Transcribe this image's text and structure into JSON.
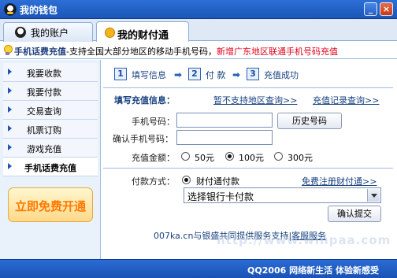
{
  "window": {
    "title": "我的钱包",
    "minimize_label": "_",
    "close_label": "×"
  },
  "tabs": [
    {
      "label": "我的账户",
      "active": false
    },
    {
      "label": "我的财付通",
      "active": true
    }
  ],
  "banner": {
    "bold": "手机话费充值",
    "text": "-支持全国大部分地区的移动手机号码，",
    "highlight": "新增广东地区联通手机号码充值"
  },
  "sidebar": {
    "items": [
      {
        "label": "我要收款",
        "active": false
      },
      {
        "label": "我要付款",
        "active": false
      },
      {
        "label": "交易查询",
        "active": false
      },
      {
        "label": "机票订购",
        "active": false
      },
      {
        "label": "游戏充值",
        "active": false
      },
      {
        "label": "手机话费充值",
        "active": true
      }
    ],
    "promo_button": "立即免费开通"
  },
  "steps": [
    {
      "num": "1",
      "label": "填写信息"
    },
    {
      "num": "2",
      "label": "付 款"
    },
    {
      "num": "3",
      "label": "充值成功"
    }
  ],
  "form": {
    "section_title": "填写充值信息：",
    "unsupported_link": "暂不支持地区查询>>",
    "history_link": "充值记录查询>>",
    "phone_label": "手机号码：",
    "phone_value": "",
    "confirm_label": "确认手机号码：",
    "confirm_value": "",
    "history_button": "历史号码",
    "amount_label": "充值金额：",
    "amounts": [
      {
        "label": "50元",
        "checked": false
      },
      {
        "label": "100元",
        "checked": true
      },
      {
        "label": "300元",
        "checked": false
      }
    ],
    "payment_label": "付款方式：",
    "payment_option": "财付通付款",
    "payment_checked": true,
    "register_link": "免费注册财付通>>",
    "bank_select": "选择银行卡付款",
    "submit_button": "确认提交"
  },
  "footer": {
    "text": "007ka.cn与银盛共同提供服务支持",
    "separator": "|",
    "service_link": "客服服务"
  },
  "statusbar": {
    "text": "QQ2006 网络新生活 体验新感受"
  },
  "watermark": "http://www.winpaa.com"
}
